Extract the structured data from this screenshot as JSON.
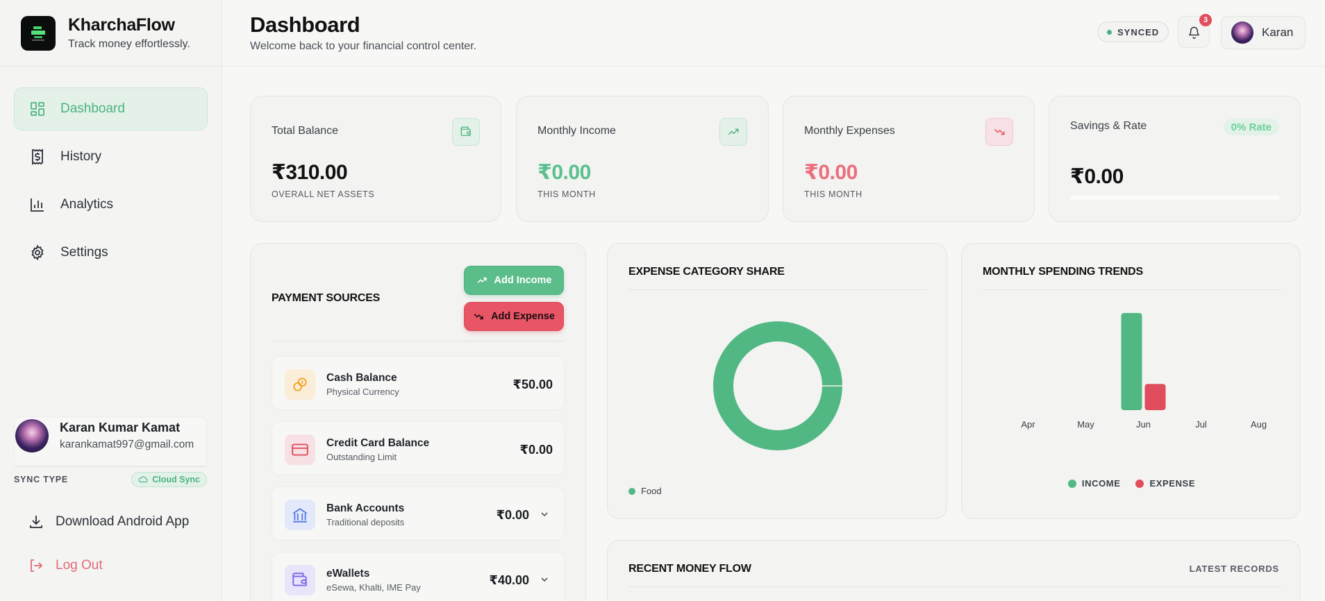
{
  "brand": {
    "name": "KharchaFlow",
    "tagline": "Track money effortlessly."
  },
  "nav": [
    {
      "label": "Dashboard",
      "icon": "dashboard-icon",
      "active": true
    },
    {
      "label": "History",
      "icon": "receipt-icon",
      "active": false
    },
    {
      "label": "Analytics",
      "icon": "bar-chart-icon",
      "active": false
    },
    {
      "label": "Settings",
      "icon": "gear-icon",
      "active": false
    }
  ],
  "user": {
    "name": "Karan Kumar Kamat",
    "email": "karankamat997@gmail.com",
    "short_name": "Karan",
    "sync_type_label": "SYNC TYPE",
    "sync_type_value": "Cloud Sync"
  },
  "sidebar_actions": {
    "download": "Download Android App",
    "logout": "Log Out"
  },
  "header": {
    "title": "Dashboard",
    "subtitle": "Welcome back to your financial control center.",
    "sync_status": "SYNCED",
    "notification_count": "3"
  },
  "stats": {
    "total_balance": {
      "label": "Total Balance",
      "value": "₹310.00",
      "sub": "OVERALL NET ASSETS"
    },
    "monthly_income": {
      "label": "Monthly Income",
      "value": "₹0.00",
      "sub": "THIS MONTH"
    },
    "monthly_expenses": {
      "label": "Monthly Expenses",
      "value": "₹0.00",
      "sub": "THIS MONTH"
    },
    "savings": {
      "label": "Savings & Rate",
      "value": "₹0.00",
      "rate": "0% Rate",
      "progress": 0
    }
  },
  "payment_sources": {
    "title": "PAYMENT SOURCES",
    "add_income": "Add Income",
    "add_expense": "Add Expense",
    "items": [
      {
        "name": "Cash Balance",
        "desc": "Physical Currency",
        "amount": "₹50.00"
      },
      {
        "name": "Credit Card Balance",
        "desc": "Outstanding Limit",
        "amount": "₹0.00"
      },
      {
        "name": "Bank Accounts",
        "desc": "Traditional deposits",
        "amount": "₹0.00"
      },
      {
        "name": "eWallets",
        "desc": "eSewa, Khalti, IME Pay",
        "amount": "₹40.00"
      }
    ]
  },
  "expense_share": {
    "title": "EXPENSE CATEGORY SHARE",
    "legend": [
      "Food"
    ]
  },
  "monthly_trends": {
    "title": "MONTHLY SPENDING TRENDS",
    "legend_income": "INCOME",
    "legend_expense": "EXPENSE"
  },
  "recent": {
    "title": "RECENT MONEY FLOW",
    "link": "LATEST RECORDS"
  },
  "colors": {
    "green": "#4bb27f",
    "red": "#e04e5d",
    "accent_bg": "#e3f1e9"
  },
  "chart_data": [
    {
      "type": "pie",
      "title": "EXPENSE CATEGORY SHARE",
      "categories": [
        "Food"
      ],
      "values": [
        100
      ]
    },
    {
      "type": "bar",
      "title": "MONTHLY SPENDING TRENDS",
      "categories": [
        "Apr",
        "May",
        "Jun",
        "Jul",
        "Aug"
      ],
      "series": [
        {
          "name": "INCOME",
          "values": [
            0,
            0,
            100,
            0,
            0
          ]
        },
        {
          "name": "EXPENSE",
          "values": [
            0,
            0,
            27,
            0,
            0
          ]
        }
      ],
      "grid": false,
      "legend": "bottom"
    }
  ]
}
